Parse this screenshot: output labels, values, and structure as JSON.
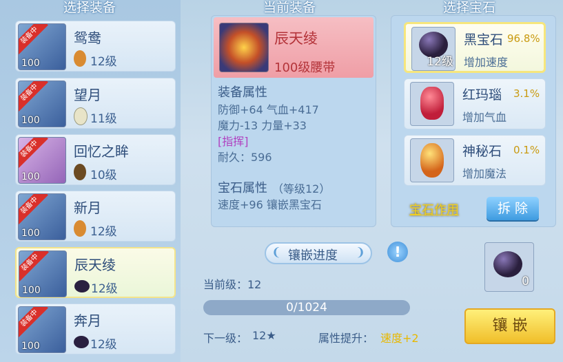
{
  "headers": {
    "left": "选择装备",
    "middle": "当前装备",
    "right": "选择宝石"
  },
  "equipment_list": [
    {
      "name": "鸳鸯",
      "level_badge": "100",
      "tag": "装备中",
      "gem_level": "12级",
      "gem_color": "#d98b32"
    },
    {
      "name": "望月",
      "level_badge": "100",
      "tag": "装备中",
      "gem_level": "11级",
      "gem_color": "#e8e4c8"
    },
    {
      "name": "回忆之眸",
      "level_badge": "100",
      "tag": "装备中",
      "gem_level": "10级",
      "gem_color": "#6b4a22"
    },
    {
      "name": "新月",
      "level_badge": "100",
      "tag": "装备中",
      "gem_level": "12级",
      "gem_color": "#d98b32"
    },
    {
      "name": "辰天绫",
      "level_badge": "100",
      "tag": "装备中",
      "gem_level": "12级",
      "gem_color": "#2a2040"
    },
    {
      "name": "奔月",
      "level_badge": "100",
      "tag": "装备中",
      "gem_level": "12级",
      "gem_color": "#2a2040"
    }
  ],
  "current_equipment": {
    "name": "辰天绫",
    "type": "100级腰带",
    "attr_title": "装备属性",
    "attr_line1": "防御+64 气血+417",
    "attr_line2": "魔力-13 力量+33",
    "special": "[指挥]",
    "durability": "耐久：596",
    "gem_attr_title": "宝石属性",
    "gem_attr_level": "（等级12）",
    "gem_attr_line": "速度+96 镶嵌黑宝石"
  },
  "gems": [
    {
      "name": "黑宝石",
      "pct": "96.8%",
      "desc": "增加速度",
      "level": "12级",
      "color": "#2a1f3d"
    },
    {
      "name": "红玛瑙",
      "pct": "3.1%",
      "desc": "增加气血",
      "color": "#d8324a"
    },
    {
      "name": "神秘石",
      "pct": "0.1%",
      "desc": "增加魔法",
      "color": "#e89a2a"
    }
  ],
  "gem_effect_label": "宝石作用",
  "remove_button": "拆 除",
  "progress": {
    "title": "镶嵌进度",
    "current_level": "当前级：12",
    "value_text": "0/1024",
    "fraction": 0,
    "next_level_label": "下一级：",
    "next_level_value": "12★",
    "attr_up_label": "属性提升：",
    "attr_up_value": "速度+2"
  },
  "slot_count": "0",
  "inlay_button": "镶 嵌",
  "info_icon": "!"
}
